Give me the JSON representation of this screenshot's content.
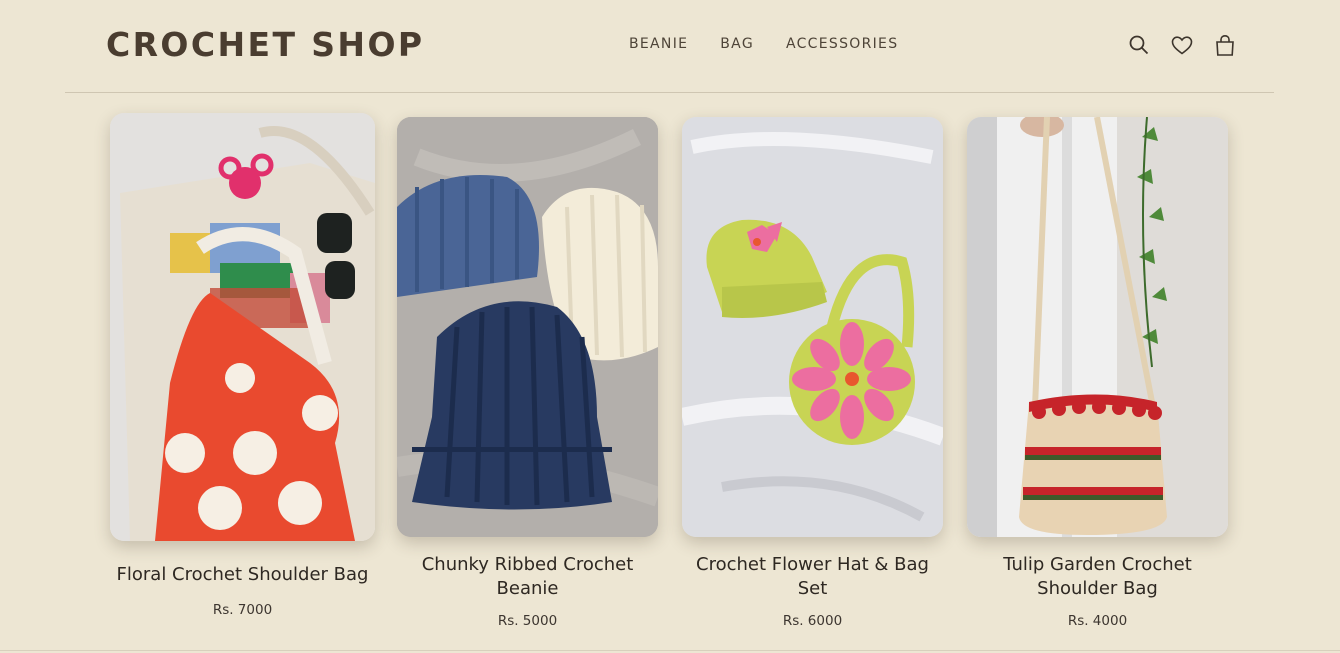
{
  "header": {
    "brand": "CROCHET SHOP",
    "nav": [
      "BEANIE",
      "BAG",
      "ACCESSORIES"
    ],
    "icons": [
      "search-icon",
      "heart-icon",
      "bag-icon"
    ]
  },
  "products": [
    {
      "title": "Floral Crochet Shoulder Bag",
      "price": "Rs. 7000"
    },
    {
      "title": "Chunky Ribbed Crochet Beanie",
      "price": "Rs. 5000"
    },
    {
      "title": "Crochet Flower Hat & Bag Set",
      "price": "Rs. 6000"
    },
    {
      "title": "Tulip Garden Crochet Shoulder Bag",
      "price": "Rs. 4000"
    }
  ],
  "colors": {
    "background": "#ede6d3",
    "text": "#3b3228"
  }
}
